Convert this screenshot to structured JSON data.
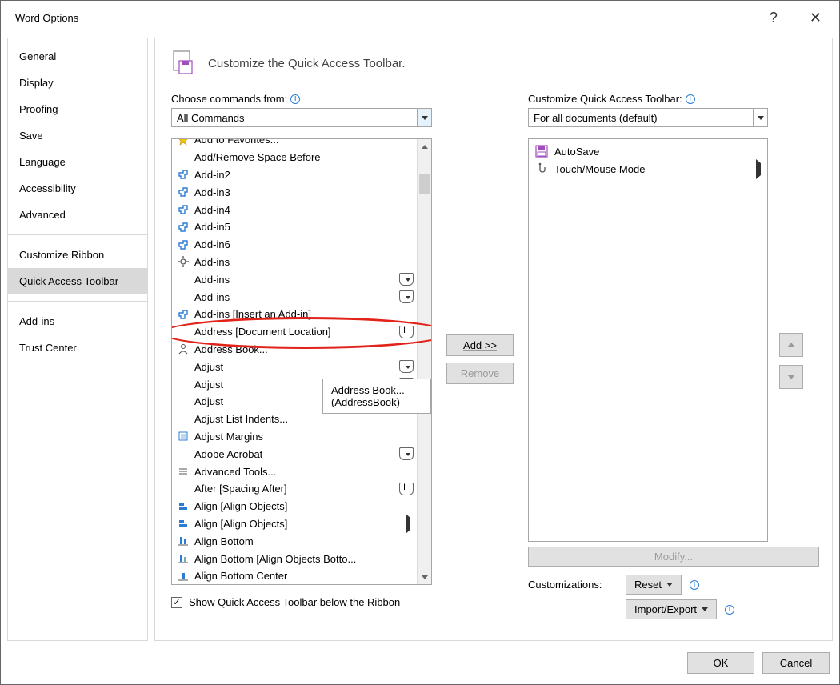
{
  "window_title": "Word Options",
  "sidebar": {
    "items": [
      "General",
      "Display",
      "Proofing",
      "Save",
      "Language",
      "Accessibility",
      "Advanced"
    ],
    "items2": [
      "Customize Ribbon",
      "Quick Access Toolbar"
    ],
    "items3": [
      "Add-ins",
      "Trust Center"
    ],
    "selected": "Quick Access Toolbar"
  },
  "header": "Customize the Quick Access Toolbar.",
  "left": {
    "label": "Choose commands from:",
    "combo_value": "All Commands",
    "checkbox_label": "Show Quick Access Toolbar below the Ribbon",
    "rows": [
      {
        "icon": "star",
        "text": "Add to Favorites...",
        "badge": ""
      },
      {
        "icon": "",
        "text": "Add/Remove Space Before",
        "badge": ""
      },
      {
        "icon": "addin",
        "text": "Add-in2",
        "badge": ""
      },
      {
        "icon": "addin",
        "text": "Add-in3",
        "badge": ""
      },
      {
        "icon": "addin",
        "text": "Add-in4",
        "badge": ""
      },
      {
        "icon": "addin",
        "text": "Add-in5",
        "badge": ""
      },
      {
        "icon": "addin",
        "text": "Add-in6",
        "badge": ""
      },
      {
        "icon": "gear",
        "text": "Add-ins",
        "badge": ""
      },
      {
        "icon": "",
        "text": "Add-ins",
        "badge": "dd"
      },
      {
        "icon": "",
        "text": "Add-ins",
        "badge": "dd"
      },
      {
        "icon": "addin",
        "text": "Add-ins [Insert an Add-in]",
        "badge": ""
      },
      {
        "icon": "",
        "text": "Address [Document Location]",
        "badge": "cursor"
      },
      {
        "icon": "person",
        "text": "Address Book...",
        "badge": ""
      },
      {
        "icon": "",
        "text": "Adjust",
        "badge": "dd"
      },
      {
        "icon": "",
        "text": "Adjust",
        "badge": "dd"
      },
      {
        "icon": "",
        "text": "Adjust",
        "badge": "dd"
      },
      {
        "icon": "",
        "text": "Adjust List Indents...",
        "badge": ""
      },
      {
        "icon": "margins",
        "text": "Adjust Margins",
        "badge": ""
      },
      {
        "icon": "",
        "text": "Adobe Acrobat",
        "badge": "dd"
      },
      {
        "icon": "tools",
        "text": "Advanced Tools...",
        "badge": ""
      },
      {
        "icon": "",
        "text": "After [Spacing After]",
        "badge": "cursor"
      },
      {
        "icon": "align",
        "text": "Align [Align Objects]",
        "badge": ""
      },
      {
        "icon": "align",
        "text": "Align [Align Objects]",
        "badge": "",
        "arrow": true
      },
      {
        "icon": "alignb",
        "text": "Align Bottom",
        "badge": ""
      },
      {
        "icon": "alignbc",
        "text": "Align Bottom [Align Objects Botto...",
        "badge": ""
      },
      {
        "icon": "alignbctr",
        "text": "Align Bottom Center",
        "badge": ""
      }
    ]
  },
  "right": {
    "label": "Customize Quick Access Toolbar:",
    "combo_value": "For all documents (default)",
    "rows": [
      {
        "icon": "save",
        "text": "AutoSave",
        "arrow": false
      },
      {
        "icon": "touch",
        "text": "Touch/Mouse Mode",
        "arrow": true
      }
    ],
    "modify": "Modify...",
    "customizations_label": "Customizations:",
    "reset": "Reset",
    "import_export": "Import/Export"
  },
  "buttons": {
    "add": "Add >>",
    "remove": "Remove",
    "ok": "OK",
    "cancel": "Cancel"
  },
  "tooltip": "Address Book... (AddressBook)"
}
